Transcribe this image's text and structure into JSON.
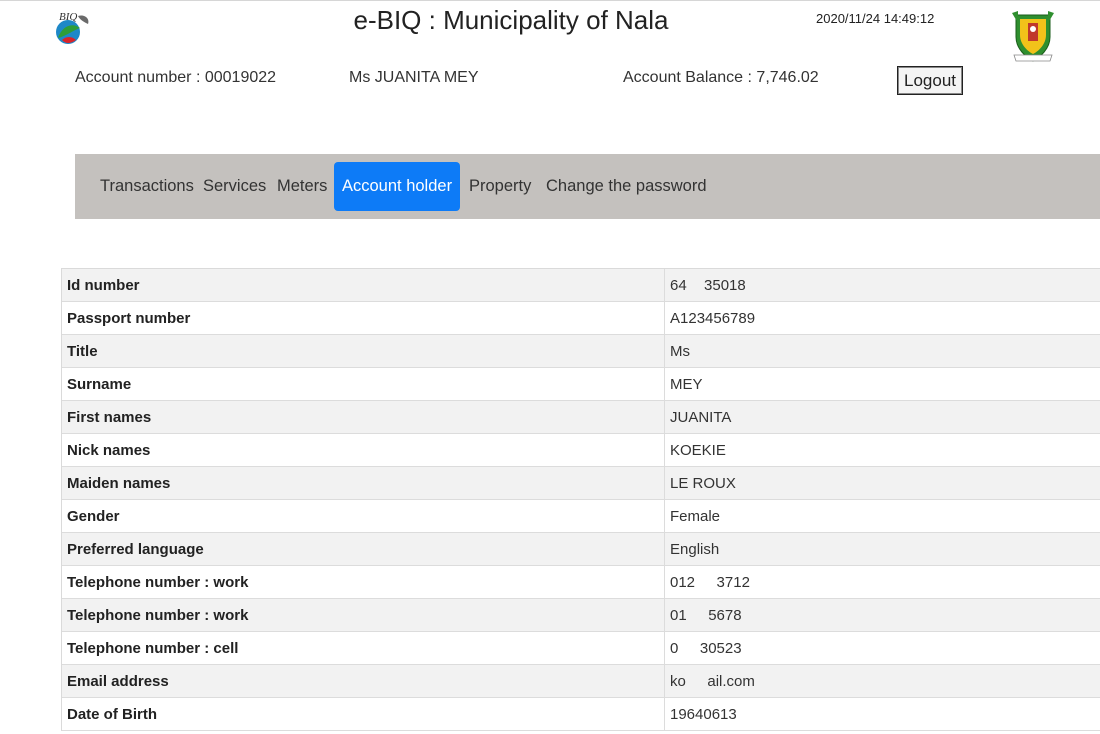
{
  "header": {
    "title": "e-BIQ : Municipality of Nala",
    "timestamp": "2020/11/24 14:49:12",
    "account_number": "Account number : 00019022",
    "account_holder": "Ms JUANITA MEY",
    "account_balance": "Account Balance : 7,746.02",
    "logout_label": "Logout",
    "left_logo_text": "BIQ"
  },
  "nav": {
    "items": [
      {
        "label": "Transactions",
        "active": false
      },
      {
        "label": "Services",
        "active": false
      },
      {
        "label": "Meters",
        "active": false
      },
      {
        "label": "Account holder",
        "active": true
      },
      {
        "label": "Property",
        "active": false
      },
      {
        "label": "Change the password",
        "active": false
      }
    ],
    "active_color": "#0d7bf7",
    "bar_color": "#c4c1be"
  },
  "details": {
    "rows": [
      {
        "label": "Id number",
        "value": "64     35018     "
      },
      {
        "label": "Passport number",
        "value": "A123456789"
      },
      {
        "label": "Title",
        "value": "Ms"
      },
      {
        "label": "Surname",
        "value": "MEY"
      },
      {
        "label": "First names",
        "value": "JUANITA"
      },
      {
        "label": "Nick names",
        "value": "KOEKIE"
      },
      {
        "label": "Maiden names",
        "value": "LE ROUX"
      },
      {
        "label": "Gender",
        "value": "Female"
      },
      {
        "label": "Preferred language",
        "value": "English"
      },
      {
        "label": "Telephone number : work",
        "value": "012      3712"
      },
      {
        "label": "Telephone number : work",
        "value": "01      5678"
      },
      {
        "label": "Telephone number : cell",
        "value": "0      30523"
      },
      {
        "label": "Email address",
        "value": "ko      ail.com"
      },
      {
        "label": "Date of Birth",
        "value": "19640613"
      }
    ]
  }
}
